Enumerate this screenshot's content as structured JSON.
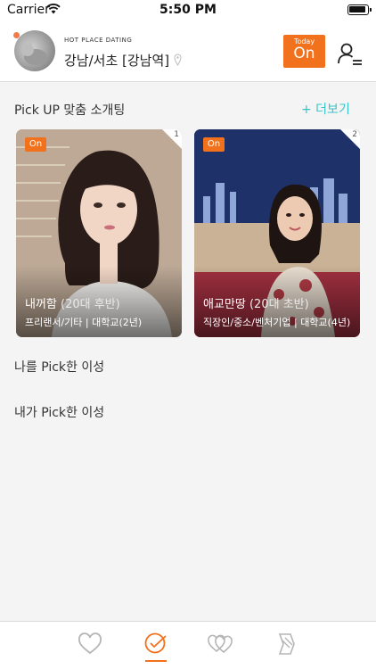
{
  "status_bar": {
    "carrier": "Carrier",
    "time": "5:50 PM"
  },
  "header": {
    "brand": "HOT PLACE DATING",
    "region": "강남/서초 [강남역]",
    "today_label": "Today",
    "today_status": "On"
  },
  "pickup": {
    "title": "Pick UP 맞춤 소개팅",
    "more": "+ 더보기",
    "cards": [
      {
        "rank": "1",
        "badge": "On",
        "nickname": "내꺼함",
        "age": "(20대 후반)",
        "details": "프리랜서/기타 | 대학교(2년)"
      },
      {
        "rank": "2",
        "badge": "On",
        "nickname": "애교만땅",
        "age": "(20대 초반)",
        "details": "직장인/중소/벤처기업 | 대학교(4년)"
      }
    ]
  },
  "sections": {
    "picked_me": "나를 Pick한 이성",
    "my_picks": "내가 Pick한 이성"
  },
  "tabbar": {
    "active_tab": "check-icon",
    "accent": "#f2711c",
    "inactive": "#b5b5b5"
  },
  "colors": {
    "accent": "#f2711c",
    "link": "#35c3c9",
    "background": "#f4f4f4"
  }
}
